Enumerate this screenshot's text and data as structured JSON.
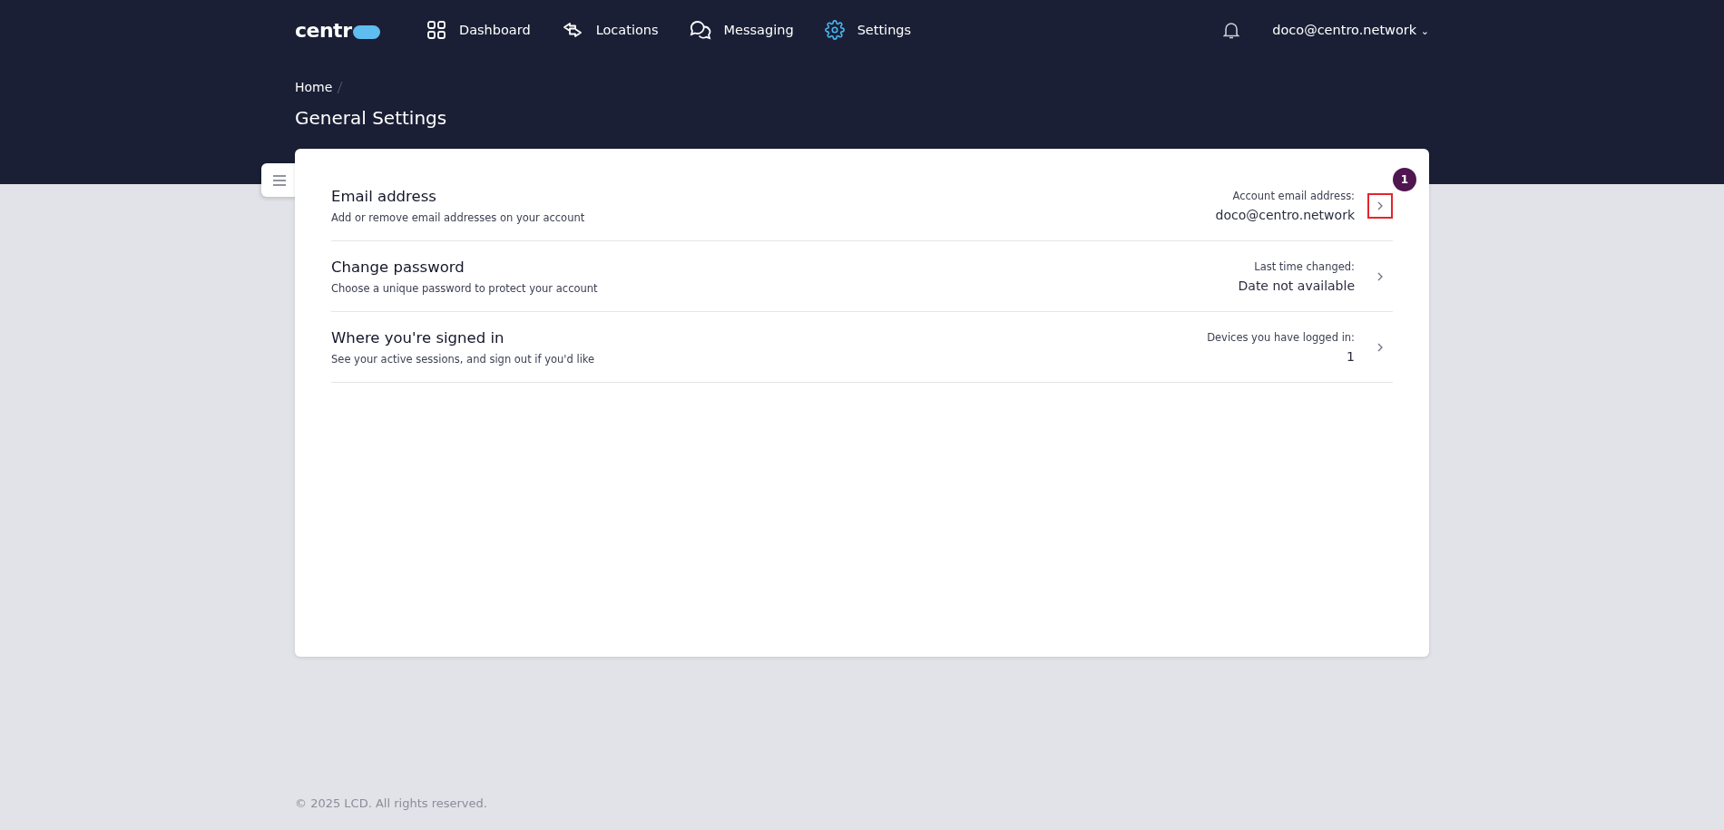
{
  "logo": {
    "text": "centr"
  },
  "nav": [
    {
      "label": "Dashboard",
      "selected": false
    },
    {
      "label": "Locations",
      "selected": false
    },
    {
      "label": "Messaging",
      "selected": false
    },
    {
      "label": "Settings",
      "selected": true
    }
  ],
  "user_menu": {
    "label": "doco@centro.network",
    "caret": "⌄"
  },
  "breadcrumb": [
    "Home"
  ],
  "page_title": "General Settings",
  "settings": [
    {
      "title": "Email address",
      "description": "Add or remove email addresses on your account",
      "detail_label": "Account email address:",
      "detail_value": "doco@centro.network",
      "highlighted": true,
      "annotation": "1"
    },
    {
      "title": "Change password",
      "description": "Choose a unique password to protect your account",
      "detail_label": "Last time changed:",
      "detail_value": "Date not available",
      "highlighted": false
    },
    {
      "title": "Where you're signed in",
      "description": "See your active sessions, and sign out if you'd like",
      "detail_label": "Devices you have logged in:",
      "detail_value": "1",
      "highlighted": false
    }
  ],
  "footer": "© 2025 LCD. All rights reserved."
}
